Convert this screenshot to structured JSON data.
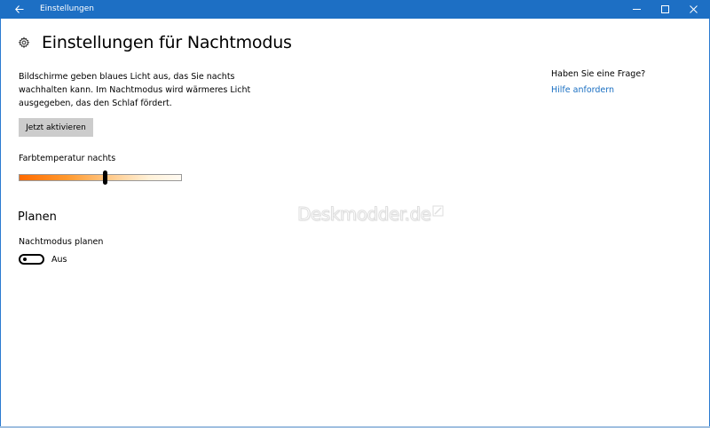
{
  "window": {
    "title": "Einstellungen",
    "accent": "#1d6fc4"
  },
  "header": {
    "icon": "gear-icon",
    "title": "Einstellungen für Nachtmodus"
  },
  "main": {
    "description": "Bildschirme geben blaues Licht aus, das Sie nachts wachhalten kann. Im Nachtmodus wird wärmeres Licht ausgegeben, das den Schlaf fördert.",
    "activate_button": "Jetzt aktivieren",
    "slider": {
      "label": "Farbtemperatur nachts",
      "value_fraction": 0.53
    },
    "schedule": {
      "heading": "Planen",
      "label": "Nachtmodus planen",
      "toggle_on": false,
      "toggle_state_text": "Aus"
    }
  },
  "help": {
    "question": "Haben Sie eine Frage?",
    "link": "Hilfe anfordern",
    "link_color": "#1a6fc2"
  },
  "watermark": {
    "text": "Deskmodder.de"
  }
}
